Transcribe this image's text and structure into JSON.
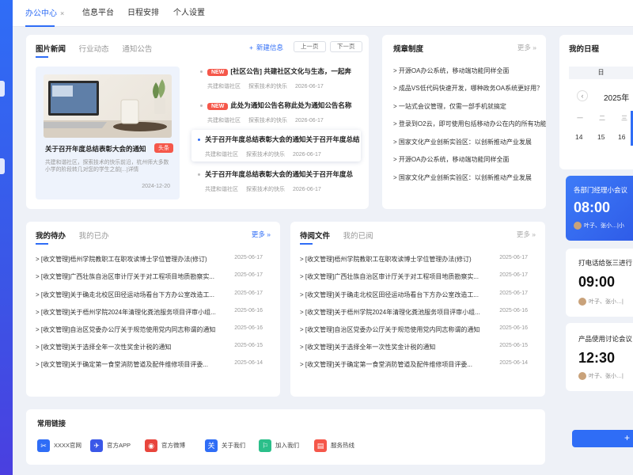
{
  "topnav": {
    "tabs": [
      "办公中心",
      "信息平台",
      "日程安排",
      "个人设置"
    ],
    "close": "×"
  },
  "news": {
    "tabs": [
      "图片新闻",
      "行业动态",
      "通知公告"
    ],
    "new_info": "新建信息",
    "prev": "上一页",
    "next": "下一页",
    "featured": {
      "title": "关于召开年度总结表彰大会的通知",
      "tag": "头条",
      "desc": "共建和谐社区，探索技术的快乐前沿，杭州师大多数小学的阶段转几对您的学生之前[...]详情",
      "date": "2024-12-20"
    },
    "items": [
      {
        "badge": "NEW",
        "title": "[社区公告] 共建社区文化与生态，一起奔",
        "src": "共建和谐社区",
        "sub": "探索技术的快乐",
        "date": "2026-06-17"
      },
      {
        "badge": "NEW",
        "title": "此处为通知公告名称此处为通知公告名称",
        "src": "共建和谐社区",
        "sub": "探索技术的快乐",
        "date": "2026-06-17"
      },
      {
        "badge": "",
        "title": "关于召开年度总结表彰大会的通知关于召开年度总结",
        "src": "共建和谐社区",
        "sub": "探索技术的快乐",
        "date": "2026-06-17"
      },
      {
        "badge": "",
        "title": "关于召开年度总结表彰大会的通知关于召开年度总",
        "src": "共建和谐社区",
        "sub": "探索技术的快乐",
        "date": "2026-06-17"
      }
    ]
  },
  "rules": {
    "title": "规章制度",
    "more": "更多",
    "items": [
      "> 开源OA办公系统，移动端功能同样全面",
      "> 成品VS低代码快速开发，哪种政务OA系统更好用？",
      "> 一站式会议管理，仅需一部手机就搞定",
      "> 登录到O2云，即可使用包括移动办公在内的所有功能!",
      "> 国家文化产业创新实验区：以创新推动产业发展",
      "> 开源OA办公系统，移动端功能同样全面",
      "> 国家文化产业创新实验区：以创新推动产业发展"
    ]
  },
  "schedule": {
    "title": "我的日程",
    "weekday": "日",
    "month": "2025年",
    "dashes": [
      "一",
      "二",
      "三"
    ],
    "days": [
      "14",
      "15",
      "16"
    ],
    "events": [
      {
        "title": "各部门经理小会议",
        "time": "08:00",
        "people": "叶子、张小…|小"
      },
      {
        "title": "打电话给张三进行",
        "time": "09:00",
        "people": "叶子、张小…|"
      },
      {
        "title": "产品使用讨论会议",
        "time": "12:30",
        "people": "叶子、张小…|"
      }
    ],
    "add": "+"
  },
  "todo": {
    "tabs": [
      "我的待办",
      "我的已办"
    ],
    "more": "更多",
    "rows": [
      {
        "t": "> [收文管理]梧州学院教职工在职攻读博士学位管理办法(修订)",
        "d": "2025-06-17"
      },
      {
        "t": "> [收文管理]广西壮族自治区审计厅关于对工程项目地质勘察实...",
        "d": "2025-06-17"
      },
      {
        "t": "> [收文管理]关于确走北校区田径运动场看台下方办公室改造工...",
        "d": "2025-06-17"
      },
      {
        "t": "> [收文管理]关于梧州学院2024年清理化粪池服务项目评审小组...",
        "d": "2025-06-16"
      },
      {
        "t": "> [收文管理]自治区党委办公厅关于规范使用党内同志称谓的通知",
        "d": "2025-06-16"
      },
      {
        "t": "> [收文管理]关于选择全年一次性奖金计税的通知",
        "d": "2025-06-15"
      },
      {
        "t": "> [收文管理]关于确定第一食堂消防管道及配件维修项目评委...",
        "d": "2025-06-14"
      }
    ]
  },
  "reading": {
    "tabs": [
      "待阅文件",
      "我的已阅"
    ],
    "more": "更多",
    "rows": [
      {
        "t": "> [收文管理]梧州学院教职工在职攻读博士学位管理办法(修订)",
        "d": "2025-06-17"
      },
      {
        "t": "> [收文管理]广西壮族自治区审计厅关于对工程项目地质勘察实...",
        "d": "2025-06-17"
      },
      {
        "t": "> [收文管理]关于确走北校区田径运动场看台下方办公室改造工...",
        "d": "2025-06-17"
      },
      {
        "t": "> [收文管理]关于梧州学院2024年清理化粪池服务项目评审小组...",
        "d": "2025-06-16"
      },
      {
        "t": "> [收文管理]自治区党委办公厅关于规范使用党内同志称谓的通知",
        "d": "2025-06-16"
      },
      {
        "t": "> [收文管理]关于选择全年一次性奖金计税的通知",
        "d": "2025-06-15"
      },
      {
        "t": "> [收文管理]关于确定第一食堂消防管道及配件维修项目评委...",
        "d": "2025-06-14"
      }
    ]
  },
  "links": {
    "title": "常用链接",
    "items": [
      {
        "label": "XXXX官网",
        "glyph": "✂",
        "color": "#2f6df6"
      },
      {
        "label": "官方APP",
        "glyph": "✈",
        "color": "#3a57e8"
      },
      {
        "label": "官方微博",
        "glyph": "◉",
        "color": "#e8453c"
      },
      {
        "label": "关于我们",
        "glyph": "关",
        "color": "#2f6df6"
      },
      {
        "label": "加入我们",
        "glyph": "⚐",
        "color": "#2bbf8a"
      },
      {
        "label": "服务热线",
        "glyph": "▤",
        "color": "#f5574a"
      }
    ]
  }
}
